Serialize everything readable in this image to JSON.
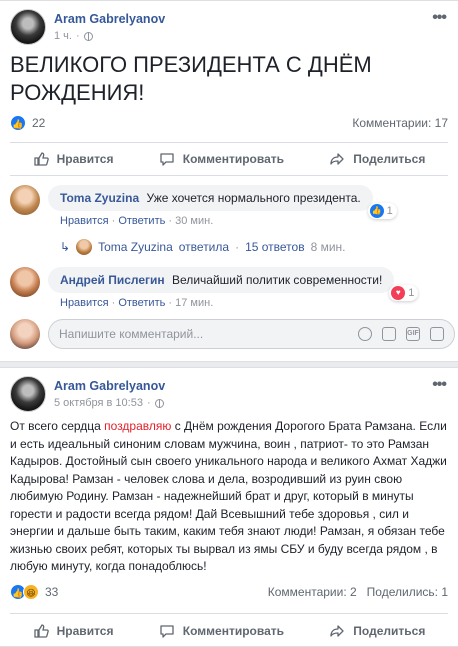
{
  "post1": {
    "author": "Aram Gabrelyanov",
    "time": "1 ч.",
    "text": "ВЕЛИКОГО ПРЕЗИДЕНТА С ДНЁМ РОЖДЕНИЯ!",
    "reactions_count": "22",
    "comments_count": "Комментарии: 17",
    "actions": {
      "like": "Нравится",
      "comment": "Комментировать",
      "share": "Поделиться"
    },
    "comments": [
      {
        "name": "Toma Zyuzina",
        "text": "Уже хочется нормального президента.",
        "links": {
          "like": "Нравится",
          "reply": "Ответить",
          "time": "30 мин."
        },
        "reaction_count": "1",
        "reaction": "like"
      },
      {
        "name": "Андрей Пислегин",
        "text": "Величайший политик современности!",
        "links": {
          "like": "Нравится",
          "reply": "Ответить",
          "time": "17 мин."
        },
        "reaction_count": "1",
        "reaction": "love"
      }
    ],
    "reply_thread": {
      "name": "Toma Zyuzina",
      "verb": "ответила",
      "count": "15 ответов",
      "time": "8 мин."
    },
    "write_placeholder": "Напишите комментарий..."
  },
  "post2": {
    "author": "Aram Gabrelyanov",
    "time": "5 октября в 10:53",
    "text_before": "От всего сердца ",
    "text_highlight": "поздравляю",
    "text_after": " с Днём рождения Дорогого Брата Рамзана. Если и есть идеальный синоним словам мужчина, воин , патриот- то это Рамзан Кадыров. Достойный сын своего уникального народа и великого Ахмат Хаджи Кадырова! Рамзан - человек слова и дела, возродивший из руин свою любимую Родину. Рамзан - надежнейший брат и друг, который в минуты горести и радости всегда рядом! Дай Всевышний тебе здоровья , сил и энергии и дальше быть таким, каким тебя знают люди! Рамзан, я обязан тебе жизнью своих ребят, которых ты вырвал из ямы СБУ и буду всегда рядом , в любую минуту, когда понадоблюсь!",
    "reactions_count": "33",
    "comments_count": "Комментарии: 2",
    "shares_count": "Поделились: 1",
    "actions": {
      "like": "Нравится",
      "comment": "Комментировать",
      "share": "Поделиться"
    }
  },
  "colors": {
    "link": "#385898",
    "accent": "#1877f2",
    "highlight": "#e2212b"
  }
}
